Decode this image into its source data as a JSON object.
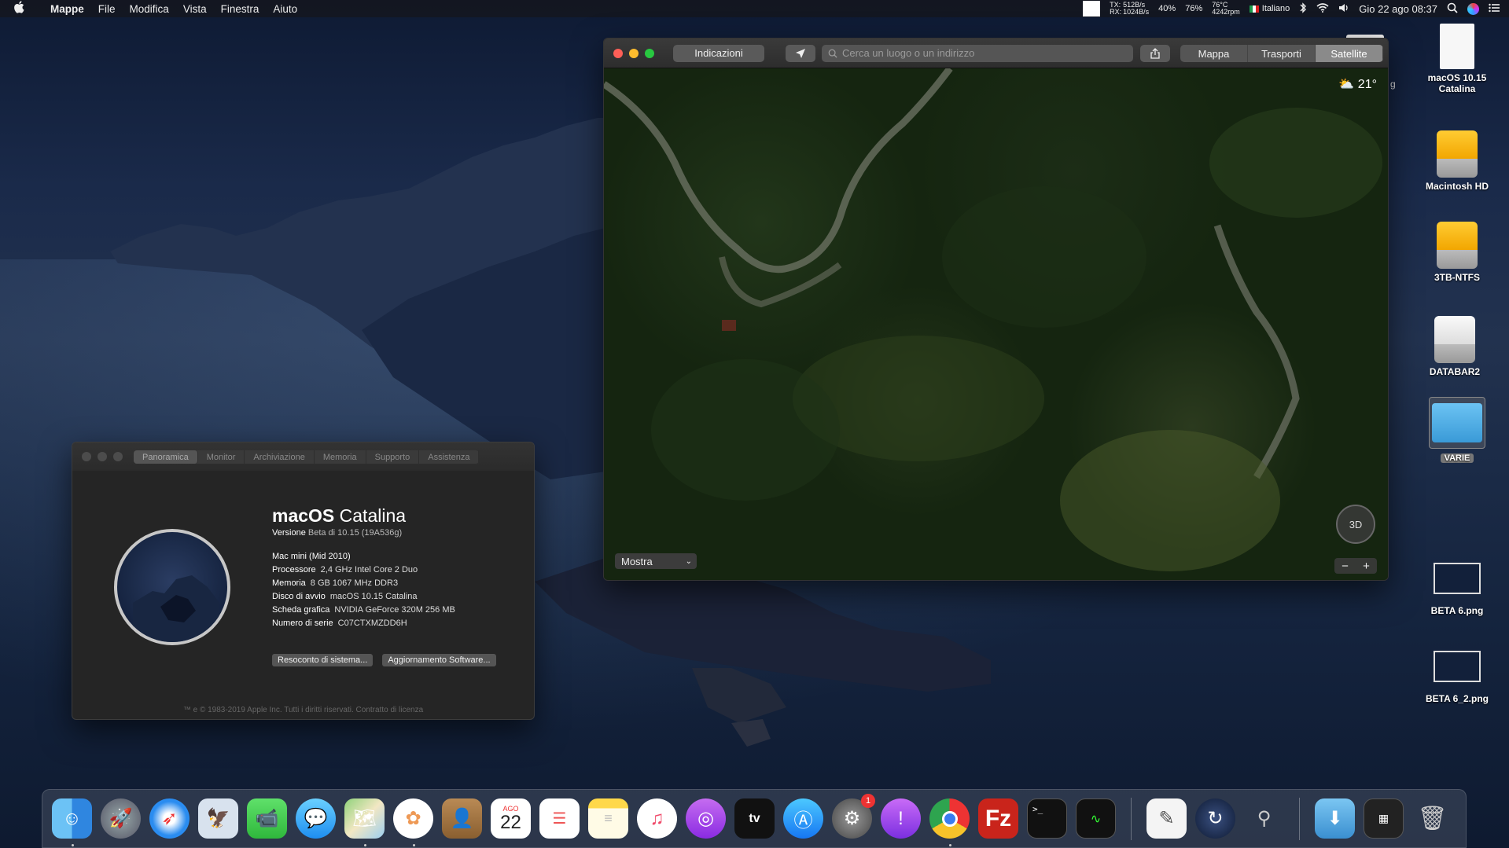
{
  "menubar": {
    "apple": "",
    "app_name": "Mappe",
    "menus": [
      "File",
      "Modifica",
      "Vista",
      "Finestra",
      "Aiuto"
    ],
    "net_labels": [
      "TX:",
      "RX:"
    ],
    "net_up": "512B/s",
    "net_down": "1024B/s",
    "cpu": "40%",
    "battery": "76%",
    "temp": "76°C",
    "fan": "4242rpm",
    "input_source": "Italiano",
    "datetime": "Gio 22 ago 08:37"
  },
  "maps": {
    "directions_label": "Indicazioni",
    "search_placeholder": "Cerca un luogo o un indirizzo",
    "modes": [
      "Mappa",
      "Trasporti",
      "Satellite"
    ],
    "active_mode": "Satellite",
    "weather": "21°",
    "show_label": "Mostra",
    "compass_label": "3D",
    "zoom_out": "−",
    "zoom_in": "+"
  },
  "about": {
    "tabs": [
      "Panoramica",
      "Monitor",
      "Archiviazione",
      "Memoria",
      "Supporto",
      "Assistenza"
    ],
    "active_tab": "Panoramica",
    "os_name_bold": "macOS",
    "os_name": "Catalina",
    "version_label": "Versione",
    "version": "Beta di 10.15 (19A536g)",
    "model": "Mac mini (Mid 2010)",
    "specs": [
      {
        "key": "Processore",
        "value": "2,4 GHz Intel Core 2 Duo"
      },
      {
        "key": "Memoria",
        "value": "8 GB 1067 MHz DDR3"
      },
      {
        "key": "Disco di avvio",
        "value": "macOS 10.15 Catalina"
      },
      {
        "key": "Scheda grafica",
        "value": "NVIDIA GeForce 320M 256 MB"
      },
      {
        "key": "Numero di serie",
        "value": "C07CTXMZDD6H"
      }
    ],
    "btn_report": "Resoconto di sistema...",
    "btn_update": "Aggiornamento Software...",
    "legal": "™ e © 1983-2019 Apple Inc. Tutti i diritti riservati. Contratto di licenza"
  },
  "desktop": {
    "icons": [
      {
        "label": "macOS 10.15 Catalina",
        "icon": "document-icon"
      },
      {
        "label": "Macintosh HD",
        "icon": "drive-icon"
      },
      {
        "label": "3TB-NTFS",
        "icon": "drive-icon"
      },
      {
        "label": "DATABAR2",
        "icon": "drive-white-icon"
      },
      {
        "label": "VARIE",
        "icon": "folder-icon"
      },
      {
        "label": "BETA 6.png",
        "icon": "image-thumb-icon"
      },
      {
        "label": "BETA 6_2.png",
        "icon": "image-thumb-icon"
      }
    ],
    "partial_label": "g"
  },
  "dock": {
    "calendar_month": "AGO",
    "calendar_day": "22",
    "sysprefs_badge": "1",
    "tv_label": "tv",
    "terminal_prompt": ">_"
  },
  "colors": {
    "accent_red": "#fe5f57",
    "accent_yellow": "#febc2e",
    "accent_green": "#28c840",
    "filezilla": "#c9241b"
  }
}
